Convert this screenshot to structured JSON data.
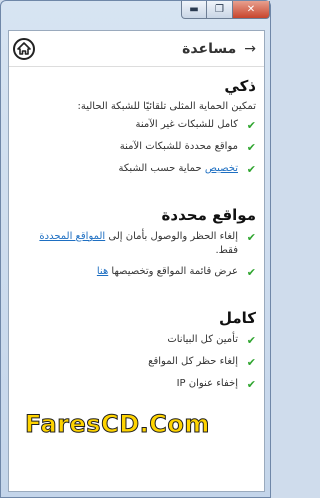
{
  "window": {
    "min_symbol": "▬",
    "max_symbol": "❐",
    "close_symbol": "✕"
  },
  "header": {
    "title": "مساعدة",
    "back_symbol": "→",
    "home_icon": "home-icon"
  },
  "sections": {
    "smart": {
      "title": "ذكي",
      "intro": "تمكين الحماية المثلى تلقائيًا للشبكة الحالية:",
      "item1": "كامل للشبكات غير الآمنة",
      "item2": "مواقع محددة للشبكات الآمنة",
      "item3_link": "تخصيص",
      "item3_rest": " حماية حسب الشبكة"
    },
    "specific": {
      "title": "مواقع محددة",
      "item1_pre": "إلغاء الحظر والوصول بأمان إلى ",
      "item1_link": "المواقع المحددة",
      "item1_post": " فقط.",
      "item2_pre": "عرض قائمة المواقع وتخصيصها ",
      "item2_link": "هنا"
    },
    "full": {
      "title": "كامل",
      "item1": "تأمين كل البيانات",
      "item2": "إلغاء حظر كل المواقع",
      "item3": "إخفاء عنوان IP"
    }
  },
  "check_symbol": "✔",
  "check_color": "#2fa52f",
  "link_color": "#1e6fc2",
  "watermark": "FaresCD.Com"
}
